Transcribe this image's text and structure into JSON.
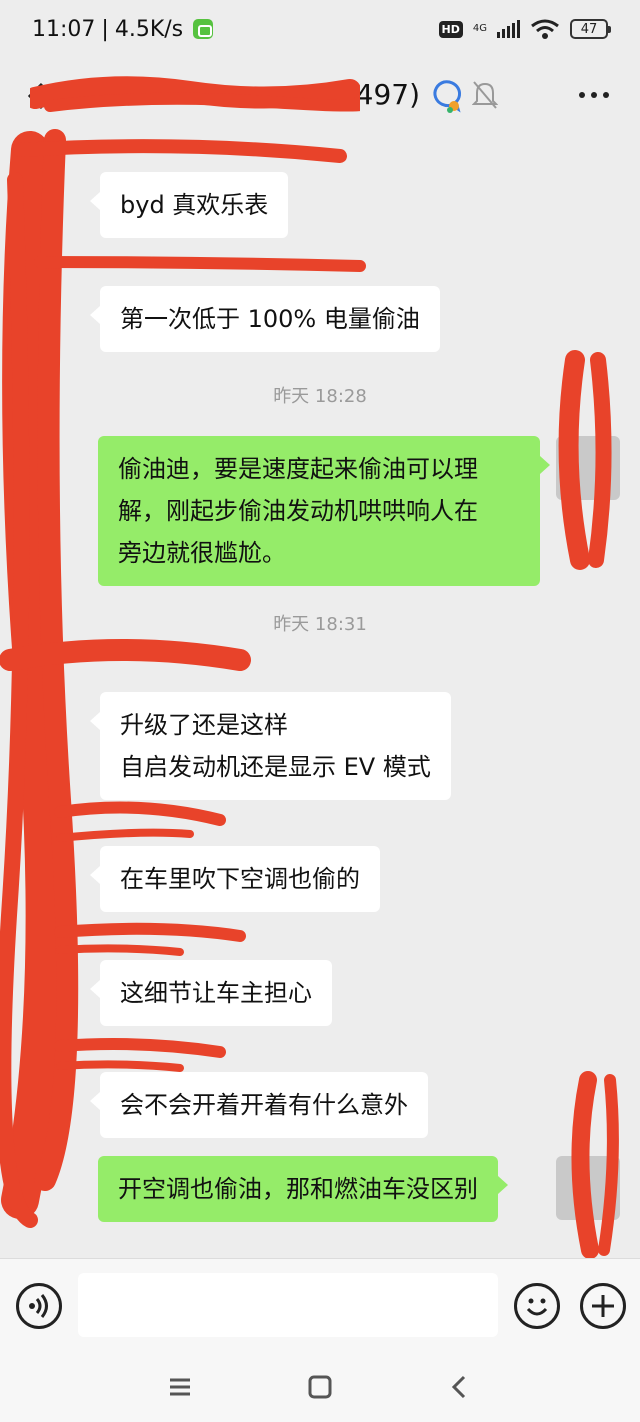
{
  "status_bar": {
    "time": "11:07",
    "separator": "|",
    "net_speed": "4.5K/s",
    "hd": "HD",
    "network_type": "4G",
    "battery": "47"
  },
  "header": {
    "title_suffix": "(497)",
    "icons": [
      "back-arrow-icon",
      "group-chat-icon",
      "mute-bell-icon",
      "more-icon"
    ]
  },
  "messages": [
    {
      "type": "in",
      "text": "byd 真欢乐表"
    },
    {
      "type": "in",
      "text": "第一次低于 100% 电量偷油"
    },
    {
      "type": "time",
      "text": "昨天 18:28"
    },
    {
      "type": "out",
      "text": "偷油迪，要是速度起来偷油可以理\n解，刚起步偷油发动机哄哄响人在\n旁边就很尴尬。"
    },
    {
      "type": "time",
      "text": "昨天 18:31"
    },
    {
      "type": "in",
      "text": "升级了还是这样\n自启发动机还是显示 EV 模式"
    },
    {
      "type": "in",
      "text": "在车里吹下空调也偷的"
    },
    {
      "type": "in",
      "text": "这细节让车主担心"
    },
    {
      "type": "in",
      "text": "会不会开着开着有什么意外"
    },
    {
      "type": "out",
      "text": "开空调也偷油，那和燃油车没区别"
    }
  ],
  "input_bar": {
    "placeholder": "",
    "icons": [
      "voice-icon",
      "emoji-icon",
      "plus-icon"
    ]
  },
  "system_nav": {
    "icons": [
      "menu-icon",
      "home-icon",
      "back-icon"
    ]
  },
  "colors": {
    "background": "#ededed",
    "outgoing_bubble": "#95ec69",
    "incoming_bubble": "#ffffff",
    "redaction": "#e8432a"
  }
}
